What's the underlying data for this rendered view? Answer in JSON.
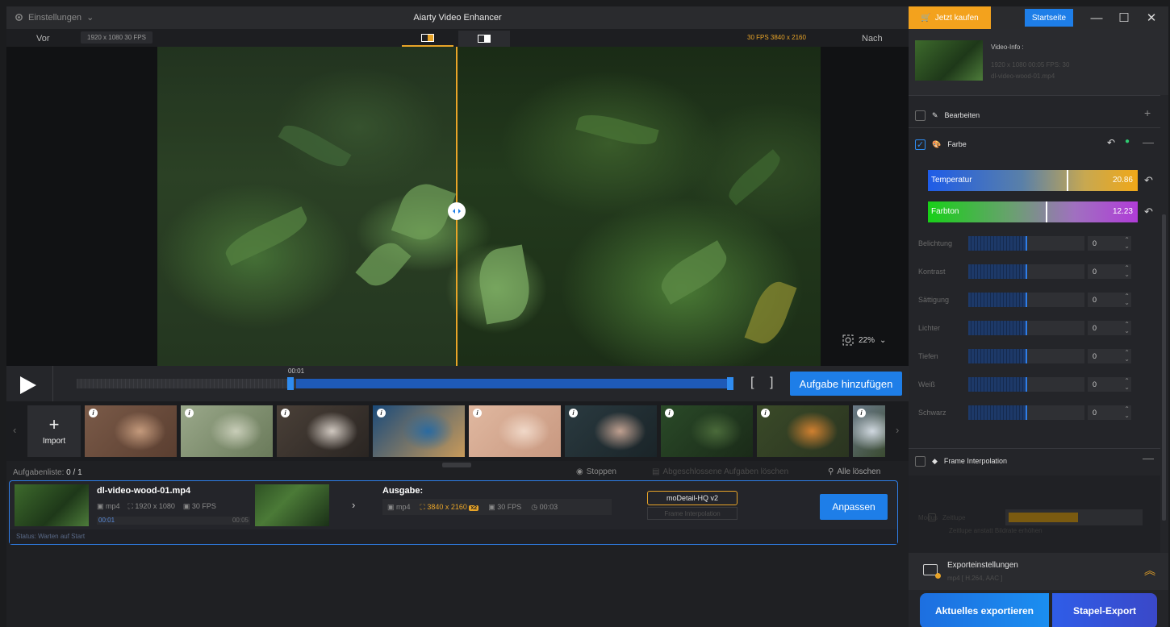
{
  "titlebar": {
    "settings_label": "Einstellungen",
    "app_title": "Aiarty Video Enhancer",
    "buy_label": "Jetzt kaufen",
    "home_label": "Startseite"
  },
  "preview": {
    "before_label": "Vor",
    "after_label": "Nach",
    "before_info": "1920 x 1080  30 FPS",
    "after_info": "30 FPS  3840 x 2160",
    "zoom": "22%"
  },
  "transport": {
    "time_label": "00:01",
    "add_task_label": "Aufgabe hinzufügen"
  },
  "thumbnails": {
    "import_label": "Import",
    "items": [
      {
        "name": "portrait-woman",
        "colors": [
          "#7a5a48",
          "#c49a7c",
          "#5a3e30"
        ]
      },
      {
        "name": "hummingbird",
        "colors": [
          "#9aa88a",
          "#c8cdb8",
          "#6a7a5a"
        ]
      },
      {
        "name": "cat",
        "colors": [
          "#4a4038",
          "#d0c8c0",
          "#2a2522"
        ]
      },
      {
        "name": "island",
        "colors": [
          "#1a4a7a",
          "#2a6aa0",
          "#c89a5a"
        ]
      },
      {
        "name": "baby",
        "colors": [
          "#e0b8a0",
          "#f0d8c8",
          "#c89880"
        ]
      },
      {
        "name": "woman-hands",
        "colors": [
          "#2a3a40",
          "#c0a090",
          "#1a2428"
        ]
      },
      {
        "name": "forest",
        "colors": [
          "#2a4a28",
          "#4a6a3a",
          "#1a2a18"
        ]
      },
      {
        "name": "tiger",
        "colors": [
          "#3a4a28",
          "#d08030",
          "#2a3420"
        ]
      },
      {
        "name": "mountains",
        "colors": [
          "#6a7a88",
          "#d0d8e0",
          "#3a4a30"
        ]
      }
    ]
  },
  "tasklist": {
    "label": "Aufgabenliste:",
    "count": "0 / 1",
    "stop_label": "Stoppen",
    "finished_label": "Abgeschlossene Aufgaben löschen",
    "clear_label": "Alle löschen"
  },
  "task": {
    "filename": "dl-video-wood-01.mp4",
    "in_format": "mp4",
    "in_res": "1920 x 1080",
    "in_fps": "30 FPS",
    "t_start": "00:01",
    "t_end": "00:05",
    "output_label": "Ausgabe:",
    "out_format": "mp4",
    "out_res": "3840 x 2160",
    "out_scale": "x2",
    "out_fps": "30 FPS",
    "out_time": "00:03",
    "model": "moDetail-HQ  v2",
    "frame_interp": "Frame Interpolation",
    "adjust_label": "Anpassen",
    "status": "Status: Warten auf Start"
  },
  "right": {
    "video_info_title": "Video-Info :",
    "video_info_line1": "1920 x 1080  00:05    FPS: 30",
    "video_info_line2": "dl-video-wood-01.mp4",
    "edit_label": "Bearbeiten",
    "color_label": "Farbe",
    "temperature_label": "Temperatur",
    "temperature_value": "20.86",
    "temperature_fraction": 0.66,
    "tint_label": "Farbton",
    "tint_value": "12.23",
    "tint_fraction": 0.56,
    "adjustments": [
      {
        "name": "Belichtung",
        "value": "0"
      },
      {
        "name": "Kontrast",
        "value": "0"
      },
      {
        "name": "Sättigung",
        "value": "0"
      },
      {
        "name": "Lichter",
        "value": "0"
      },
      {
        "name": "Tiefen",
        "value": "0"
      },
      {
        "name": "Weiß",
        "value": "0"
      },
      {
        "name": "Schwarz",
        "value": "0"
      }
    ],
    "frame_interp_label": "Frame Interpolation",
    "fi_mode_label": "Modus",
    "fi_slow_label": "Zeitlupe",
    "fi_slow_sub": "Zeitlupe anstatt Bildrate erhöhen",
    "export_settings_title": "Exporteinstellungen",
    "export_settings_sub": "mp4 [ H.264, AAC ]",
    "export_current_label": "Aktuelles exportieren",
    "export_batch_label": "Stapel-Export"
  },
  "colors": {
    "accent": "#1e7ee8",
    "highlight": "#e8a428"
  }
}
